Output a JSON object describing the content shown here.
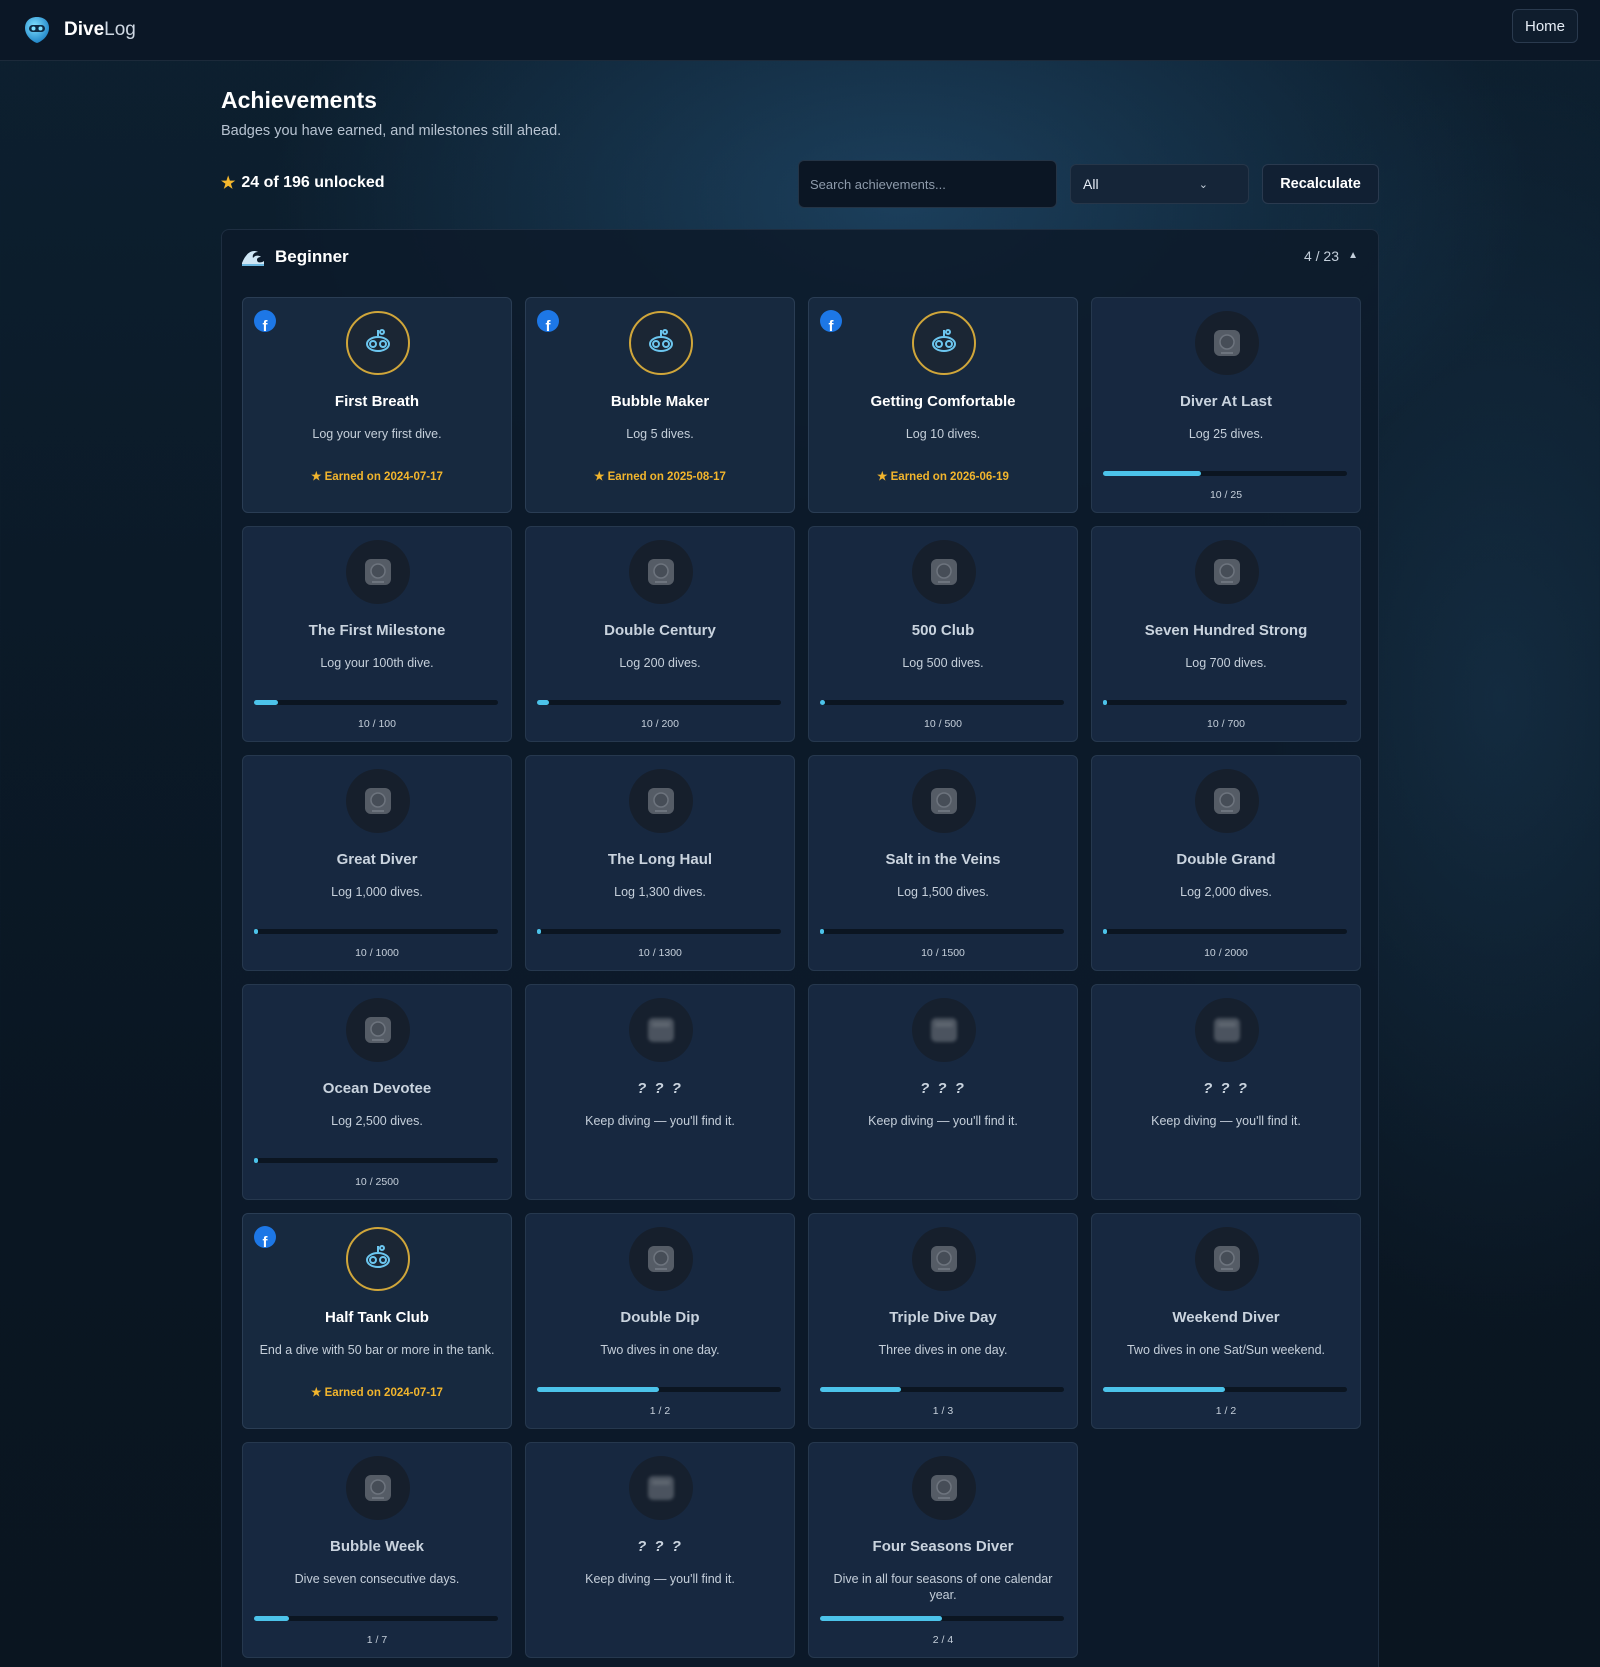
{
  "app": {
    "brand_bold": "Dive",
    "brand_light": "Log",
    "home_label": "Home"
  },
  "page": {
    "title": "Achievements",
    "subtitle": "Badges you have earned, and milestones still ahead.",
    "unlocked_text": "24 of 196 unlocked",
    "search_placeholder": "Search achievements...",
    "filter_value": "All",
    "recalc_label": "Recalculate"
  },
  "colors": {
    "accent": "#4cc3ea",
    "gold": "#f2b52d",
    "facebook": "#1d77e6"
  },
  "section": {
    "title": "Beginner",
    "count": "4 / 23",
    "icon": "wave-icon",
    "caret": "▲"
  },
  "cards": [
    {
      "state": "earned",
      "name": "First Breath",
      "desc": "Log your very first dive.",
      "earned": "Earned on 2024-07-17",
      "icon": "diver-mask-icon",
      "share": "f"
    },
    {
      "state": "earned",
      "name": "Bubble Maker",
      "desc": "Log 5 dives.",
      "earned": "Earned on 2025-08-17",
      "icon": "bubbles-icon",
      "share": "f"
    },
    {
      "state": "earned",
      "name": "Getting Comfortable",
      "desc": "Log 10 dives.",
      "earned": "Earned on 2026-06-19",
      "icon": "mask-icon",
      "share": "f"
    },
    {
      "state": "locked",
      "name": "Diver At Last",
      "desc": "Log 25 dives.",
      "progress": "10 / 25",
      "fraction": 0.4,
      "icon": "snorkel-icon"
    },
    {
      "state": "locked",
      "name": "The First Milestone",
      "desc": "Log your 100th dive.",
      "progress": "10 / 100",
      "fraction": 0.1,
      "icon": "wreath-medal-icon"
    },
    {
      "state": "locked",
      "name": "Double Century",
      "desc": "Log 200 dives.",
      "progress": "10 / 200",
      "fraction": 0.05,
      "icon": "medal-200-icon"
    },
    {
      "state": "locked",
      "name": "500 Club",
      "desc": "Log 500 dives.",
      "progress": "10 / 500",
      "fraction": 0.02,
      "icon": "medal-500-icon"
    },
    {
      "state": "locked",
      "name": "Seven Hundred Strong",
      "desc": "Log 700 dives.",
      "progress": "10 / 700",
      "fraction": 0.014,
      "icon": "medal-700-icon"
    },
    {
      "state": "locked",
      "name": "Great Diver",
      "desc": "Log 1,000 dives.",
      "progress": "10 / 1000",
      "fraction": 0.01,
      "icon": "trophy-icon"
    },
    {
      "state": "locked",
      "name": "The Long Haul",
      "desc": "Log 1,300 dives.",
      "progress": "10 / 1300",
      "fraction": 0.008,
      "icon": "medal-1300-icon"
    },
    {
      "state": "locked",
      "name": "Salt in the Veins",
      "desc": "Log 1,500 dives.",
      "progress": "10 / 1500",
      "fraction": 0.007,
      "icon": "medal-1500-icon"
    },
    {
      "state": "locked",
      "name": "Double Grand",
      "desc": "Log 2,000 dives.",
      "progress": "10 / 2000",
      "fraction": 0.005,
      "icon": "medal-2000-icon"
    },
    {
      "state": "locked",
      "name": "Ocean Devotee",
      "desc": "Log 2,500 dives.",
      "progress": "10 / 2500",
      "fraction": 0.004,
      "icon": "medal-2500-icon"
    },
    {
      "state": "secret",
      "name": "? ? ?",
      "desc": "Keep diving — you'll find it.",
      "icon": "hidden-badge-icon"
    },
    {
      "state": "secret",
      "name": "? ? ?",
      "desc": "Keep diving — you'll find it.",
      "icon": "hidden-badge-icon"
    },
    {
      "state": "secret",
      "name": "? ? ?",
      "desc": "Keep diving — you'll find it.",
      "icon": "hidden-badge-icon"
    },
    {
      "state": "earned",
      "name": "Half Tank Club",
      "desc": "End a dive with 50 bar or more in the tank.",
      "earned": "Earned on 2024-07-17",
      "icon": "tank-icon",
      "share": "f"
    },
    {
      "state": "locked",
      "name": "Double Dip",
      "desc": "Two dives in one day.",
      "progress": "1 / 2",
      "fraction": 0.5,
      "icon": "double-dip-icon"
    },
    {
      "state": "locked",
      "name": "Triple Dive Day",
      "desc": "Three dives in one day.",
      "progress": "1 / 3",
      "fraction": 0.333,
      "icon": "triple-dive-icon"
    },
    {
      "state": "locked",
      "name": "Weekend Diver",
      "desc": "Two dives in one Sat/Sun weekend.",
      "progress": "1 / 2",
      "fraction": 0.5,
      "icon": "sun-moon-icon"
    },
    {
      "state": "locked",
      "name": "Bubble Week",
      "desc": "Dive seven consecutive days.",
      "progress": "1 / 7",
      "fraction": 0.143,
      "icon": "bubble-week-icon"
    },
    {
      "state": "secret",
      "name": "? ? ?",
      "desc": "Keep diving — you'll find it.",
      "icon": "hidden-badge-icon"
    },
    {
      "state": "locked",
      "name": "Four Seasons Diver",
      "desc": "Dive in all four seasons of one calendar year.",
      "progress": "2 / 4",
      "fraction": 0.5,
      "icon": "four-seasons-icon"
    }
  ]
}
